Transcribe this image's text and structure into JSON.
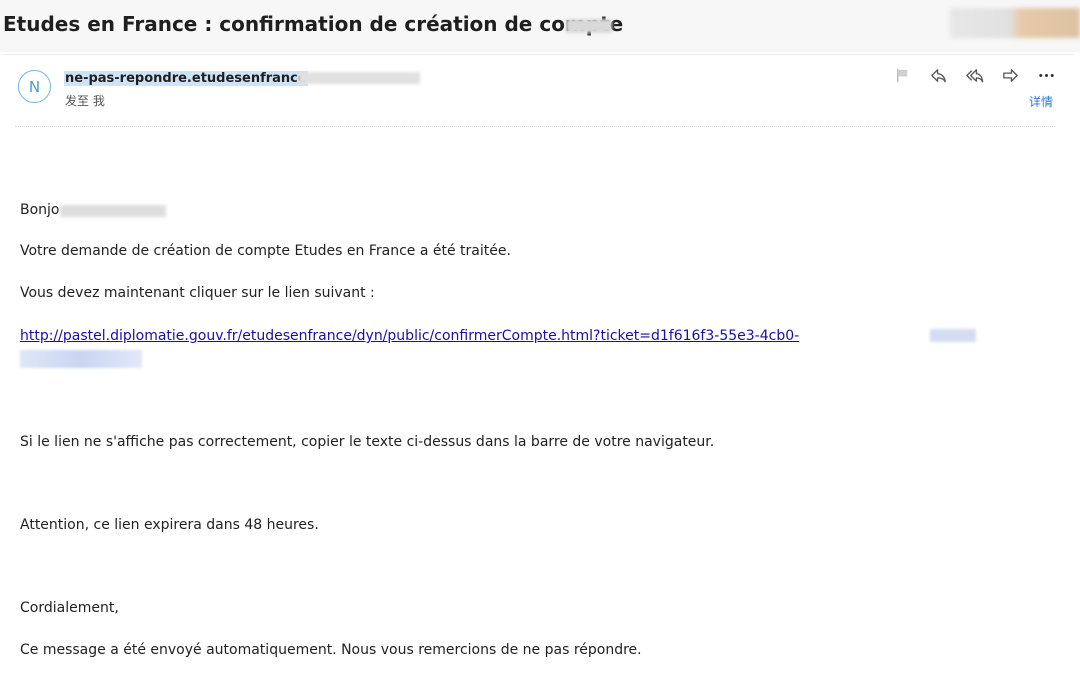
{
  "email": {
    "subject": "Etudes en France : confirmation de création de compte",
    "sender_initial": "N",
    "sender": "ne-pas-repondre.etudesenfrance",
    "recipient": "发至 我",
    "details_label": "详情",
    "actions": [
      {
        "name": "flag",
        "icon": "flag-icon"
      },
      {
        "name": "reply",
        "icon": "reply-icon"
      },
      {
        "name": "reply-all",
        "icon": "reply-all-icon"
      },
      {
        "name": "forward",
        "icon": "forward-icon"
      },
      {
        "name": "more",
        "icon": "more-icon"
      }
    ],
    "body": {
      "greeting": "Bonjo",
      "line1": "Votre demande de création de compte Etudes en France a été traitée.",
      "line2": "Vous devez maintenant cliquer sur le lien suivant :",
      "link": "http://pastel.diplomatie.gouv.fr/etudesenfrance/dyn/public/confirmerCompte.html?ticket=d1f616f3-55e3-4cb0-",
      "line3": "Si le lien ne s'affiche pas correctement, copier le texte ci-dessus dans la barre de votre navigateur.",
      "line4": "Attention, ce lien expirera dans 48 heures.",
      "closing": "Cordialement,",
      "footer": "Ce message a été envoyé automatiquement. Nous vous remercions de ne pas répondre."
    }
  },
  "colors": {
    "accent": "#2a7bd6",
    "link": "#1a0dab",
    "avatar": "#6fb3e8",
    "sender_highlight": "#cfe3f6"
  }
}
